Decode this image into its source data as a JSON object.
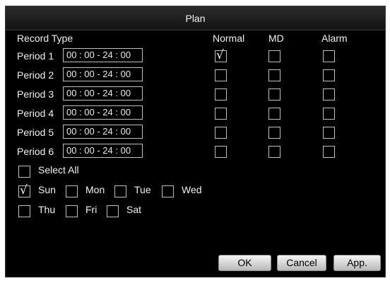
{
  "dialog": {
    "title": "Plan"
  },
  "header": {
    "record_type": "Record Type",
    "normal": "Normal",
    "md": "MD",
    "alarm": "Alarm"
  },
  "periods": [
    {
      "label": "Period 1",
      "time": "00 : 00 - 24 : 00",
      "normal": true,
      "md": false,
      "alarm": false
    },
    {
      "label": "Period 2",
      "time": "00 : 00 - 24 : 00",
      "normal": false,
      "md": false,
      "alarm": false
    },
    {
      "label": "Period 3",
      "time": "00 : 00 - 24 : 00",
      "normal": false,
      "md": false,
      "alarm": false
    },
    {
      "label": "Period 4",
      "time": "00 : 00 - 24 : 00",
      "normal": false,
      "md": false,
      "alarm": false
    },
    {
      "label": "Period 5",
      "time": "00 : 00 - 24 : 00",
      "normal": false,
      "md": false,
      "alarm": false
    },
    {
      "label": "Period 6",
      "time": "00 : 00 - 24 : 00",
      "normal": false,
      "md": false,
      "alarm": false
    }
  ],
  "select_all": {
    "label": "Select All",
    "checked": false
  },
  "days": [
    {
      "label": "Sun",
      "checked": true
    },
    {
      "label": "Mon",
      "checked": false
    },
    {
      "label": "Tue",
      "checked": false
    },
    {
      "label": "Wed",
      "checked": false
    },
    {
      "label": "Thu",
      "checked": false
    },
    {
      "label": "Fri",
      "checked": false
    },
    {
      "label": "Sat",
      "checked": false
    }
  ],
  "buttons": {
    "ok": "OK",
    "cancel": "Cancel",
    "apply": "App."
  },
  "check_glyph": "√",
  "colors": {
    "background": "#000000",
    "text": "#f0f0f0",
    "border": "#bdbdbd"
  }
}
